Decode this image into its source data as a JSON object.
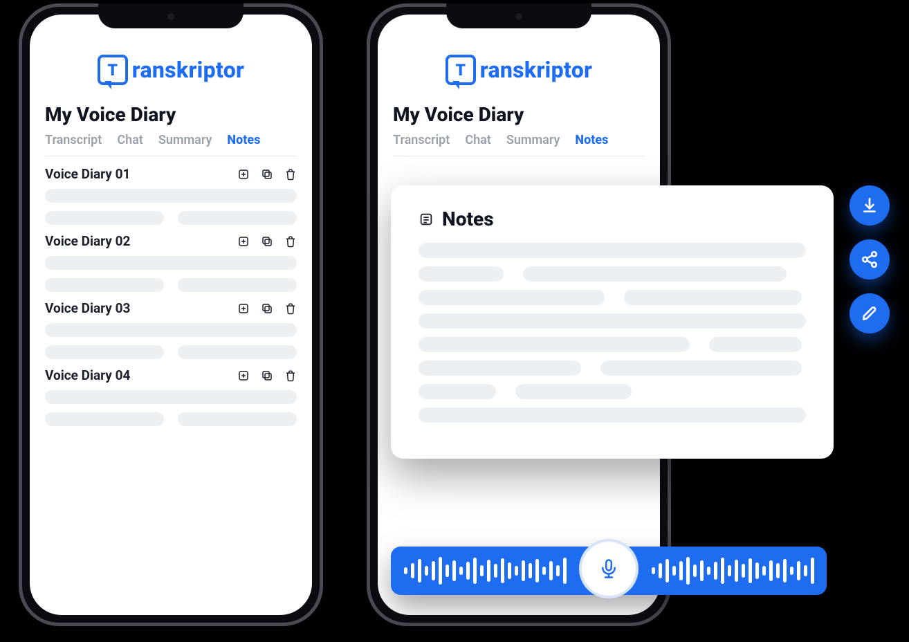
{
  "brand": "ranskriptor",
  "brand_letter": "T",
  "pages": {
    "left": {
      "title": "My Voice Diary",
      "tabs": [
        "Transcript",
        "Chat",
        "Summary",
        "Notes"
      ],
      "active_tab": "Notes",
      "entries": [
        {
          "title": "Voice Diary 01"
        },
        {
          "title": "Voice Diary 02"
        },
        {
          "title": "Voice Diary 03"
        },
        {
          "title": "Voice Diary 04"
        }
      ]
    },
    "right": {
      "title": "My Voice Diary",
      "tabs": [
        "Transcript",
        "Chat",
        "Summary",
        "Notes"
      ],
      "active_tab": "Notes",
      "notes_heading": "Notes"
    }
  },
  "icons": {
    "add": "add-icon",
    "copy": "copy-icon",
    "trash": "trash-icon",
    "notes": "notes-icon",
    "download": "download-icon",
    "share": "share-icon",
    "edit": "edit-icon",
    "mic": "microphone-icon"
  }
}
